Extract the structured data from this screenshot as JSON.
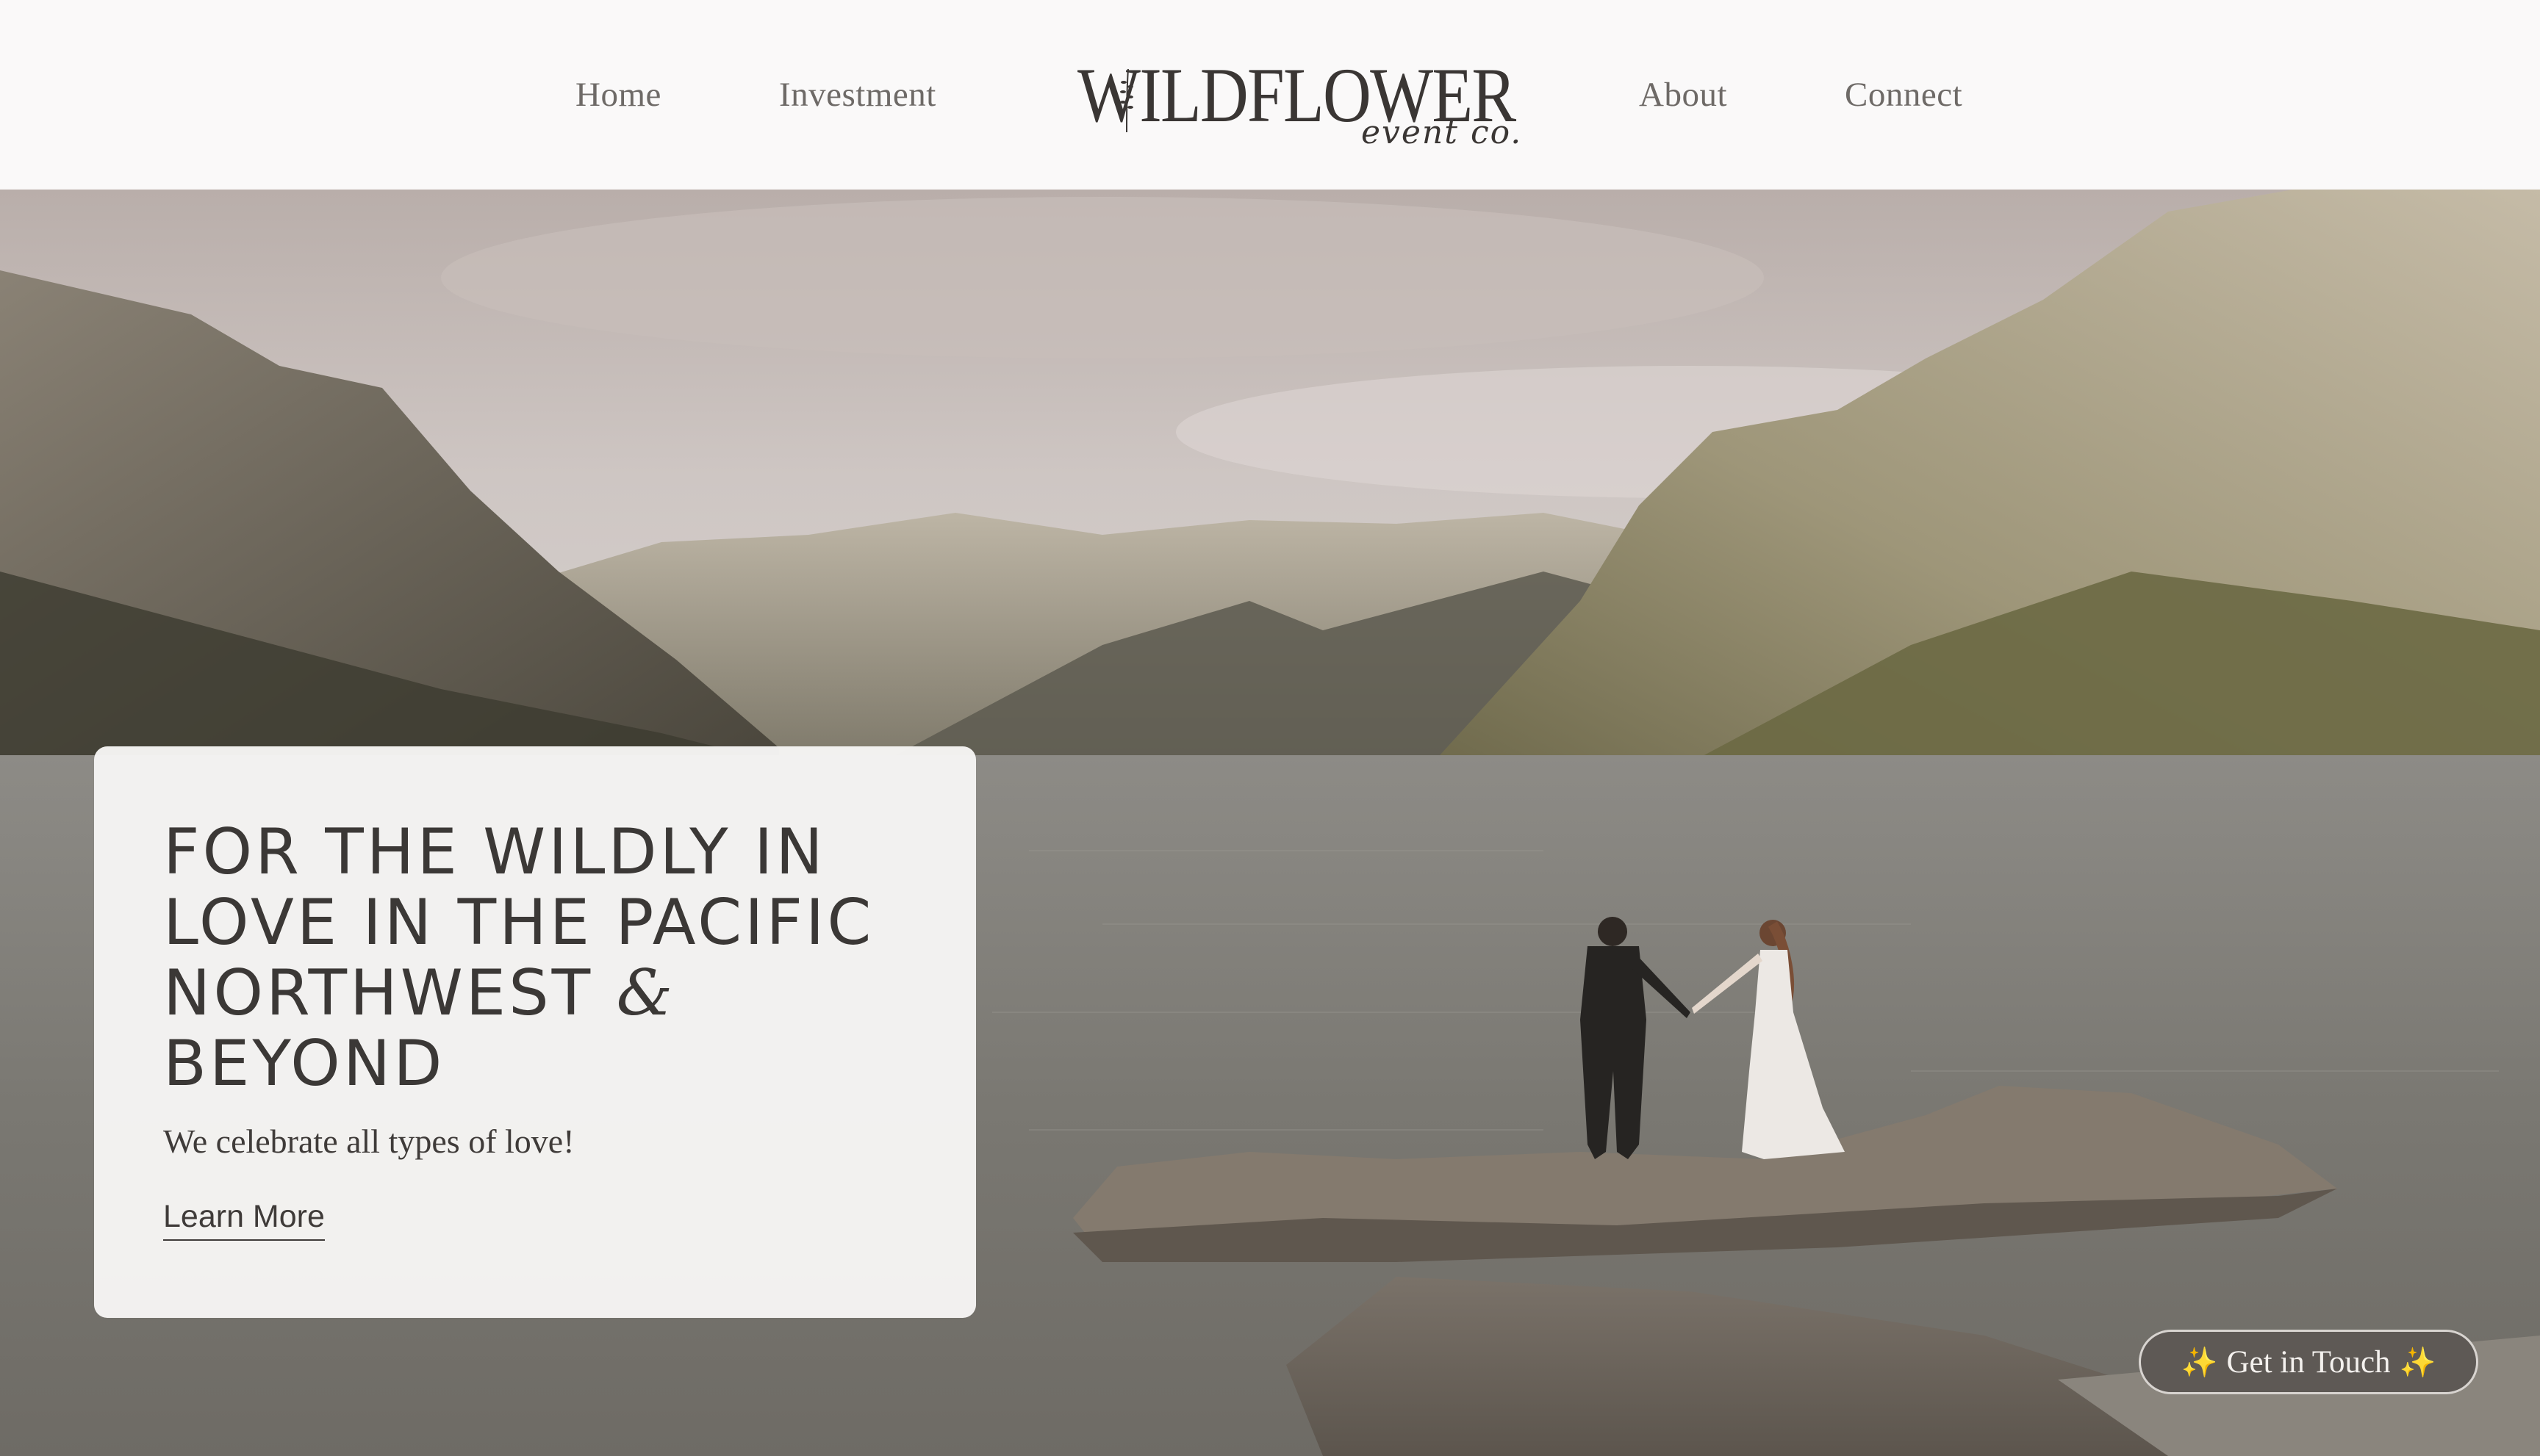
{
  "nav": {
    "home": "Home",
    "investment": "Investment",
    "about": "About",
    "connect": "Connect"
  },
  "logo": {
    "main": "WILDFLOWER",
    "sub": "event co."
  },
  "hero_card": {
    "heading_line1": "FOR THE WILDLY IN",
    "heading_line2": "LOVE IN THE PACIFIC",
    "heading_line3_text": "NORTHWEST ",
    "heading_line3_amp": "&",
    "heading_line4": "BEYOND",
    "text": "We celebrate all types of love!",
    "link": "Learn More"
  },
  "cta": {
    "label": "Get in Touch",
    "icon": "sparkles-icon"
  },
  "colors": {
    "header_bg": "#faf9f9",
    "text_dark": "#3b3836",
    "cta_bg": "#5e5955"
  }
}
